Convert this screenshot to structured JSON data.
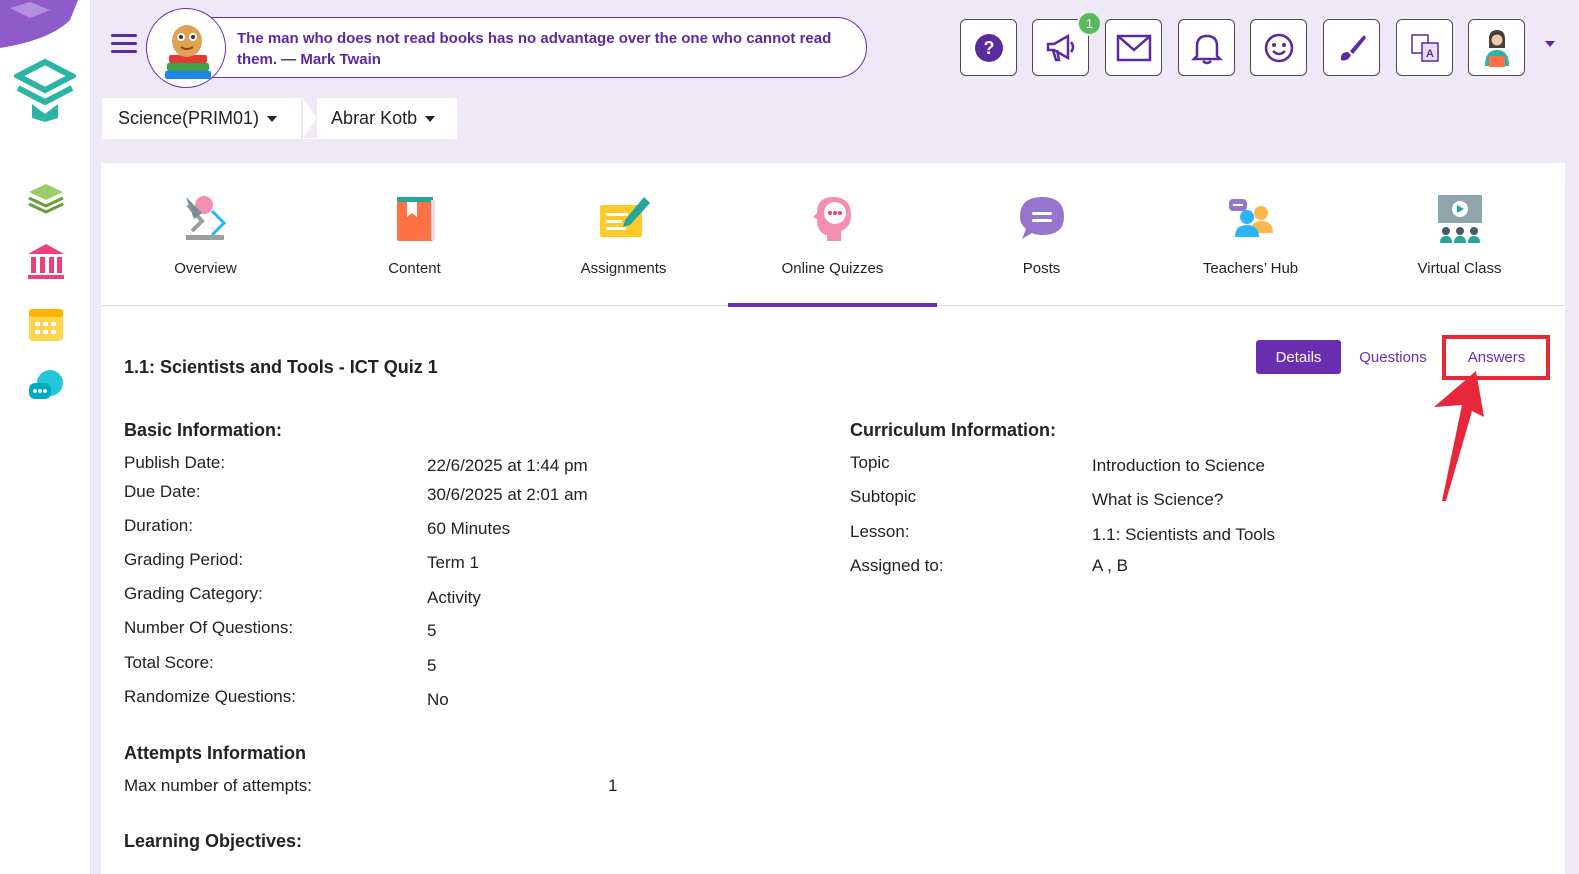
{
  "header": {
    "quote": "The man who does not read books has no advantage over the one who cannot read them. — Mark Twain",
    "notification_badge": "1"
  },
  "breadcrumb": {
    "course": "Science(PRIM01)",
    "teacher": "Abrar Kotb"
  },
  "tabs": [
    {
      "label": "Overview"
    },
    {
      "label": "Content"
    },
    {
      "label": "Assignments"
    },
    {
      "label": "Online Quizzes"
    },
    {
      "label": "Posts"
    },
    {
      "label": "Teachers’ Hub"
    },
    {
      "label": "Virtual Class"
    }
  ],
  "quiz": {
    "title": "1.1: Scientists and Tools - ICT Quiz 1",
    "buttons": {
      "details": "Details",
      "questions": "Questions",
      "answers": "Answers"
    }
  },
  "basic": {
    "heading": "Basic Information:",
    "rows": [
      {
        "label": "Publish Date:",
        "value": "22/6/2025 at 1:44 pm"
      },
      {
        "label": "Due Date:",
        "value": "30/6/2025 at 2:01 am"
      },
      {
        "label": "Duration:",
        "value": "60 Minutes"
      },
      {
        "label": "Grading Period:",
        "value": "Term 1"
      },
      {
        "label": "Grading Category:",
        "value": "Activity"
      },
      {
        "label": "Number Of Questions:",
        "value": "5"
      },
      {
        "label": "Total Score:",
        "value": "5"
      },
      {
        "label": "Randomize Questions:",
        "value": "No"
      }
    ]
  },
  "curriculum": {
    "heading": "Curriculum Information:",
    "rows": [
      {
        "label": "Topic",
        "value": "Introduction to Science"
      },
      {
        "label": "Subtopic",
        "value": "What is Science?"
      },
      {
        "label": "Lesson:",
        "value": "1.1: Scientists and Tools"
      },
      {
        "label": "Assigned to:",
        "value": "A , B"
      }
    ]
  },
  "attempts": {
    "heading": "Attempts Information",
    "label": "Max number of attempts:",
    "value": "1"
  },
  "objectives": {
    "heading": "Learning Objectives:"
  },
  "colors": {
    "accent": "#6a2fb0",
    "background": "#efe8f7",
    "highlight": "#e8283a",
    "badge": "#5cb85c"
  },
  "icons": {
    "toolbar": [
      "help-icon",
      "announcement-icon",
      "mail-icon",
      "bell-icon",
      "smiley-icon",
      "brush-icon",
      "translate-icon",
      "profile-icon"
    ],
    "rail": [
      "layers-icon",
      "institution-icon",
      "calendar-icon",
      "chat-icon"
    ]
  }
}
